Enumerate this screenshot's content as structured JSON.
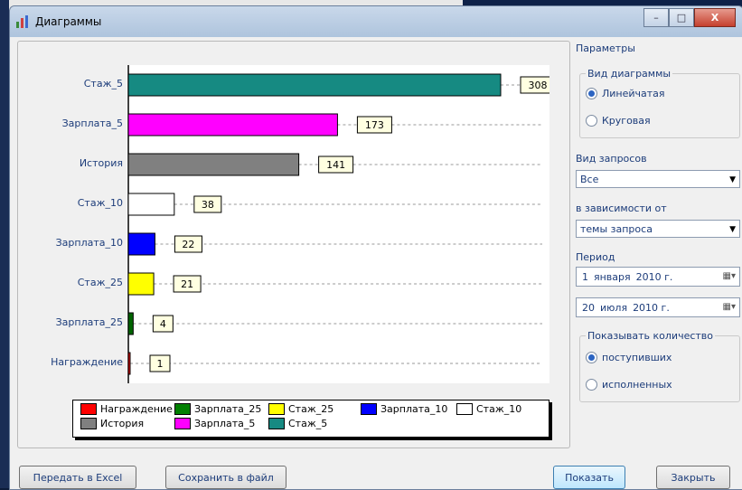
{
  "window": {
    "title": "Диаграммы",
    "minimize": "–",
    "maximize": "□",
    "close": "X"
  },
  "chart_data": {
    "type": "bar",
    "orientation": "horizontal",
    "categories": [
      "Стаж_5",
      "Зарплата_5",
      "История",
      "Стаж_10",
      "Зарплата_10",
      "Стаж_25",
      "Зарплата_25",
      "Награждение"
    ],
    "values": [
      308,
      173,
      141,
      38,
      22,
      21,
      4,
      1
    ],
    "colors": [
      "#168a82",
      "#ff00ff",
      "#808080",
      "#ffffff",
      "#0000ff",
      "#ffff00",
      "#006400",
      "#ff0000"
    ],
    "xlim": [
      0,
      308
    ],
    "legend": [
      {
        "name": "Награждение",
        "color": "#ff0000"
      },
      {
        "name": "Зарплата_25",
        "color": "#008000"
      },
      {
        "name": "Стаж_25",
        "color": "#ffff00"
      },
      {
        "name": "Зарплата_10",
        "color": "#0000ff"
      },
      {
        "name": "Стаж_10",
        "color": "#ffffff"
      },
      {
        "name": "История",
        "color": "#808080"
      },
      {
        "name": "Зарплата_5",
        "color": "#ff00ff"
      },
      {
        "name": "Стаж_5",
        "color": "#168a82"
      }
    ]
  },
  "params": {
    "title": "Параметры",
    "chart_type": {
      "title": "Вид диаграммы",
      "bar": "Линейчатая",
      "pie": "Круговая",
      "selected": "bar"
    },
    "query_type": {
      "label": "Вид запросов",
      "value": "Все"
    },
    "depends_on": {
      "label": "в зависимости от",
      "value": "темы запроса"
    },
    "period": {
      "label": "Период",
      "from": {
        "day": "1",
        "month": "января",
        "year": "2010 г."
      },
      "to": {
        "day": "20",
        "month": "июля",
        "year": "2010 г."
      }
    },
    "show_count": {
      "title": "Показывать количество",
      "received": "поступивших",
      "completed": "исполненных",
      "selected": "received"
    }
  },
  "buttons": {
    "excel": "Передать в Excel",
    "save": "Сохранить в файл",
    "show": "Показать",
    "close": "Закрыть"
  }
}
